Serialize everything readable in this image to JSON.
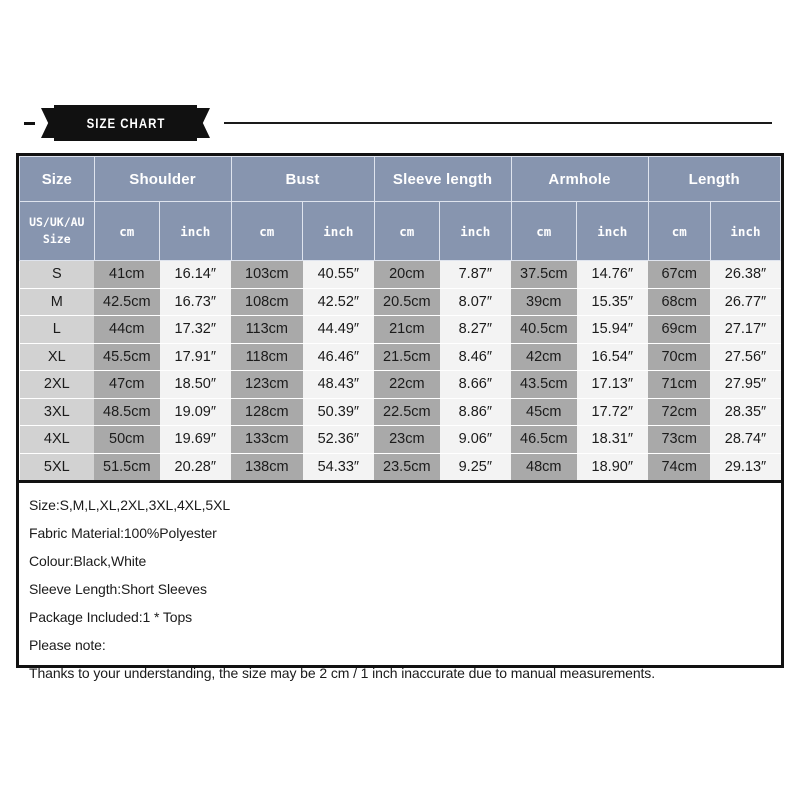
{
  "banner": {
    "title": "SIZE CHART"
  },
  "table": {
    "group_headers": [
      "Size",
      "Shoulder",
      "Bust",
      "Sleeve length",
      "Armhole",
      "Length"
    ],
    "size_sub_header": [
      "US/UK/AU",
      "Size"
    ],
    "unit_labels": [
      "cm",
      "inch"
    ],
    "rows": [
      {
        "size": "S",
        "shoulder_cm": "41cm",
        "shoulder_in": "16.14″",
        "bust_cm": "103cm",
        "bust_in": "40.55″",
        "sleeve_cm": "20cm",
        "sleeve_in": "7.87″",
        "armhole_cm": "37.5cm",
        "armhole_in": "14.76″",
        "length_cm": "67cm",
        "length_in": "26.38″"
      },
      {
        "size": "M",
        "shoulder_cm": "42.5cm",
        "shoulder_in": "16.73″",
        "bust_cm": "108cm",
        "bust_in": "42.52″",
        "sleeve_cm": "20.5cm",
        "sleeve_in": "8.07″",
        "armhole_cm": "39cm",
        "armhole_in": "15.35″",
        "length_cm": "68cm",
        "length_in": "26.77″"
      },
      {
        "size": "L",
        "shoulder_cm": "44cm",
        "shoulder_in": "17.32″",
        "bust_cm": "113cm",
        "bust_in": "44.49″",
        "sleeve_cm": "21cm",
        "sleeve_in": "8.27″",
        "armhole_cm": "40.5cm",
        "armhole_in": "15.94″",
        "length_cm": "69cm",
        "length_in": "27.17″"
      },
      {
        "size": "XL",
        "shoulder_cm": "45.5cm",
        "shoulder_in": "17.91″",
        "bust_cm": "118cm",
        "bust_in": "46.46″",
        "sleeve_cm": "21.5cm",
        "sleeve_in": "8.46″",
        "armhole_cm": "42cm",
        "armhole_in": "16.54″",
        "length_cm": "70cm",
        "length_in": "27.56″"
      },
      {
        "size": "2XL",
        "shoulder_cm": "47cm",
        "shoulder_in": "18.50″",
        "bust_cm": "123cm",
        "bust_in": "48.43″",
        "sleeve_cm": "22cm",
        "sleeve_in": "8.66″",
        "armhole_cm": "43.5cm",
        "armhole_in": "17.13″",
        "length_cm": "71cm",
        "length_in": "27.95″"
      },
      {
        "size": "3XL",
        "shoulder_cm": "48.5cm",
        "shoulder_in": "19.09″",
        "bust_cm": "128cm",
        "bust_in": "50.39″",
        "sleeve_cm": "22.5cm",
        "sleeve_in": "8.86″",
        "armhole_cm": "45cm",
        "armhole_in": "17.72″",
        "length_cm": "72cm",
        "length_in": "28.35″"
      },
      {
        "size": "4XL",
        "shoulder_cm": "50cm",
        "shoulder_in": "19.69″",
        "bust_cm": "133cm",
        "bust_in": "52.36″",
        "sleeve_cm": "23cm",
        "sleeve_in": "9.06″",
        "armhole_cm": "46.5cm",
        "armhole_in": "18.31″",
        "length_cm": "73cm",
        "length_in": "28.74″"
      },
      {
        "size": "5XL",
        "shoulder_cm": "51.5cm",
        "shoulder_in": "20.28″",
        "bust_cm": "138cm",
        "bust_in": "54.33″",
        "sleeve_cm": "23.5cm",
        "sleeve_in": "9.25″",
        "armhole_cm": "48cm",
        "armhole_in": "18.90″",
        "length_cm": "74cm",
        "length_in": "29.13″"
      }
    ]
  },
  "notes": [
    "Size:S,M,L,XL,2XL,3XL,4XL,5XL",
    "Fabric Material:100%Polyester",
    "Colour:Black,White",
    "Sleeve Length:Short Sleeves",
    "Package Included:1 * Tops",
    "Please note:",
    "Thanks to your understanding, the size may be 2 cm / 1 inch inaccurate due to manual measurements."
  ],
  "colors": {
    "header_bg": "#8795af",
    "cm_cell_bg": "#a9a9a9",
    "inch_cell_bg": "#f3f3f3",
    "size_cell_bg": "#d2d2d2",
    "banner_bg": "#111111",
    "border": "#111111"
  }
}
